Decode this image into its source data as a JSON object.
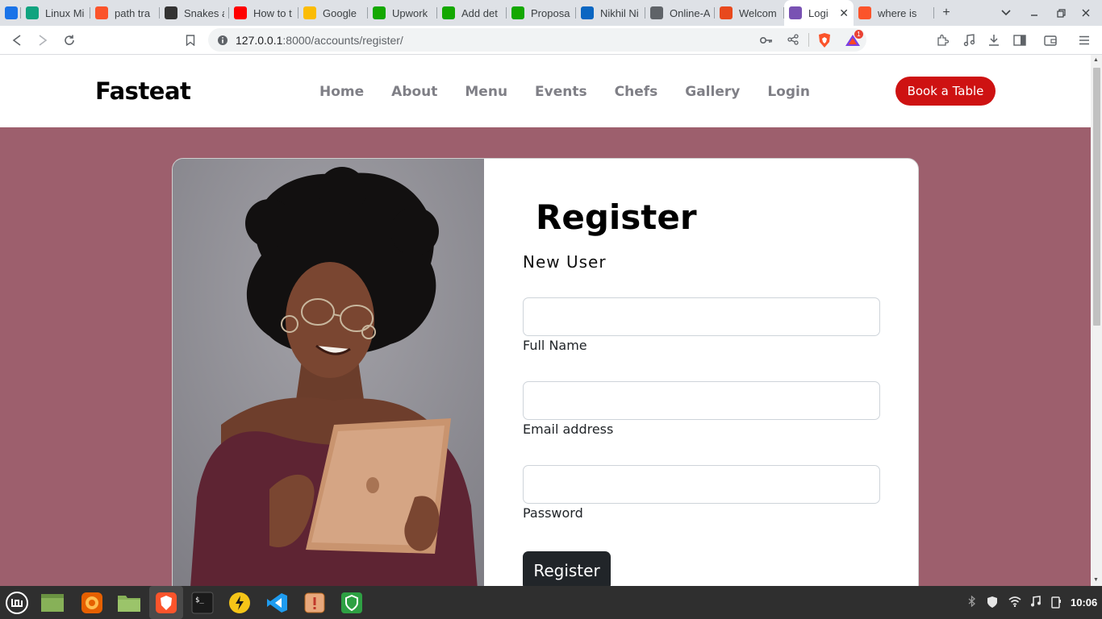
{
  "browser": {
    "tabs": [
      {
        "title": "",
        "icon": "brave-rewards-icon",
        "color": "#1a73e8"
      },
      {
        "title": "Linux Mi",
        "icon": "chatgpt-icon",
        "color": "#10a37f"
      },
      {
        "title": "path tra",
        "icon": "brave-icon",
        "color": "#fb542b"
      },
      {
        "title": "Snakes a",
        "icon": "snake-icon",
        "color": "#333333"
      },
      {
        "title": "How to t",
        "icon": "youtube-icon",
        "color": "#ff0000"
      },
      {
        "title": "Google",
        "icon": "google-keep-icon",
        "color": "#fbbc04"
      },
      {
        "title": "Upwork",
        "icon": "upwork-icon",
        "color": "#14a800"
      },
      {
        "title": "Add det",
        "icon": "upwork-icon",
        "color": "#14a800"
      },
      {
        "title": "Proposa",
        "icon": "upwork-icon",
        "color": "#14a800"
      },
      {
        "title": "Nikhil Ni",
        "icon": "linkedin-icon",
        "color": "#0a66c2"
      },
      {
        "title": "Online-A",
        "icon": "globe-icon",
        "color": "#5f6368"
      },
      {
        "title": "Welcom",
        "icon": "fire-icon",
        "color": "#e8491d"
      },
      {
        "title": "Logi",
        "icon": "bootstrap-icon",
        "color": "#7952b3",
        "active": true
      },
      {
        "title": "where is",
        "icon": "brave-icon",
        "color": "#fb542b"
      }
    ],
    "new_tab_label": "+",
    "url_host": "127.0.0.1",
    "url_path": ":8000/accounts/register/",
    "rewards_badge": "1"
  },
  "site": {
    "logo": "Fasteat",
    "nav": [
      "Home",
      "About",
      "Menu",
      "Events",
      "Chefs",
      "Gallery",
      "Login"
    ],
    "cta": "Book a Table",
    "cta_color": "#ce1212",
    "page_bg": "#9d5f6d"
  },
  "form": {
    "title": "Register",
    "subtitle": "New User",
    "fields": [
      {
        "label": "Full Name",
        "value": ""
      },
      {
        "label": "Email address",
        "value": ""
      },
      {
        "label": "Password",
        "value": ""
      }
    ],
    "submit": "Register"
  },
  "taskbar": {
    "apps": [
      "mint-menu-icon",
      "show-desktop-icon",
      "firefox-icon",
      "files-icon",
      "brave-icon",
      "terminal-icon",
      "power-icon",
      "vscode-icon",
      "update-manager-icon",
      "shield-icon"
    ],
    "clock": "10:06"
  }
}
